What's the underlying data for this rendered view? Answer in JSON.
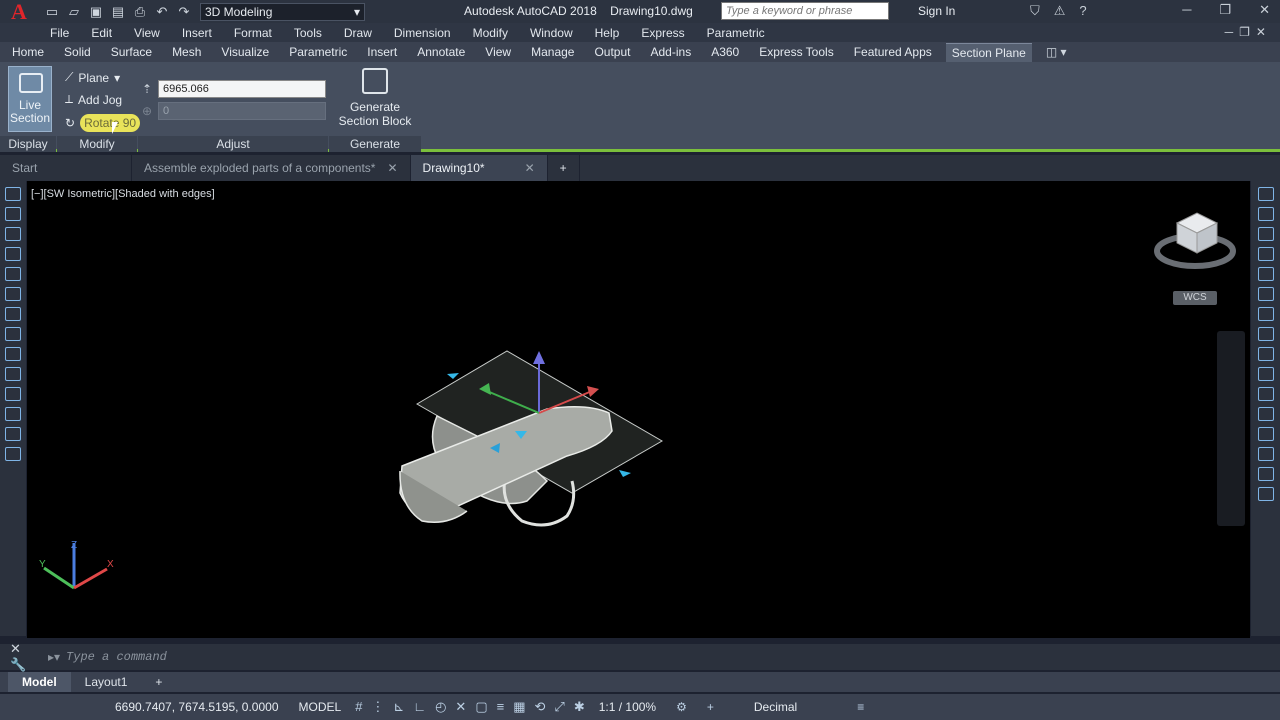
{
  "titlebar": {
    "logo": "A",
    "workspace": "3D Modeling",
    "app_title": "Autodesk AutoCAD 2018    Drawing10.dwg",
    "search_placeholder": "Type a keyword or phrase",
    "sign_in": "Sign In"
  },
  "menu": [
    "File",
    "Edit",
    "View",
    "Insert",
    "Format",
    "Tools",
    "Draw",
    "Dimension",
    "Modify",
    "Window",
    "Help",
    "Express",
    "Parametric"
  ],
  "ribbon_tabs": [
    "Home",
    "Solid",
    "Surface",
    "Mesh",
    "Visualize",
    "Parametric",
    "Insert",
    "Annotate",
    "View",
    "Manage",
    "Output",
    "Add-ins",
    "A360",
    "Express Tools",
    "Featured Apps",
    "Section Plane"
  ],
  "ribbon": {
    "live_section": "Live Section",
    "plane": "Plane",
    "add_jog": "Add Jog",
    "rotate": "Rotate 90",
    "offset_value": "6965.066",
    "angle_value": "0",
    "generate": "Generate Section Block",
    "panels": {
      "display": "Display",
      "modify": "Modify",
      "adjust": "Adjust",
      "generate": "Generate"
    }
  },
  "file_tabs": [
    {
      "label": "Start"
    },
    {
      "label": "Assemble exploded parts of a components*"
    },
    {
      "label": "Drawing10*"
    }
  ],
  "viewport": {
    "label": "[−][SW Isometric][Shaded with edges]",
    "wcs": "WCS"
  },
  "command": {
    "placeholder": "Type a command"
  },
  "layout_tabs": [
    "Model",
    "Layout1"
  ],
  "status": {
    "coords": "6690.7407, 7674.5195, 0.0000",
    "model": "MODEL",
    "scale": "1:1 / 100%",
    "units": "Decimal"
  },
  "colors": {
    "accent": "#7bbf3c",
    "logo_red": "#e0262b",
    "viewport_bg": "#000000"
  }
}
